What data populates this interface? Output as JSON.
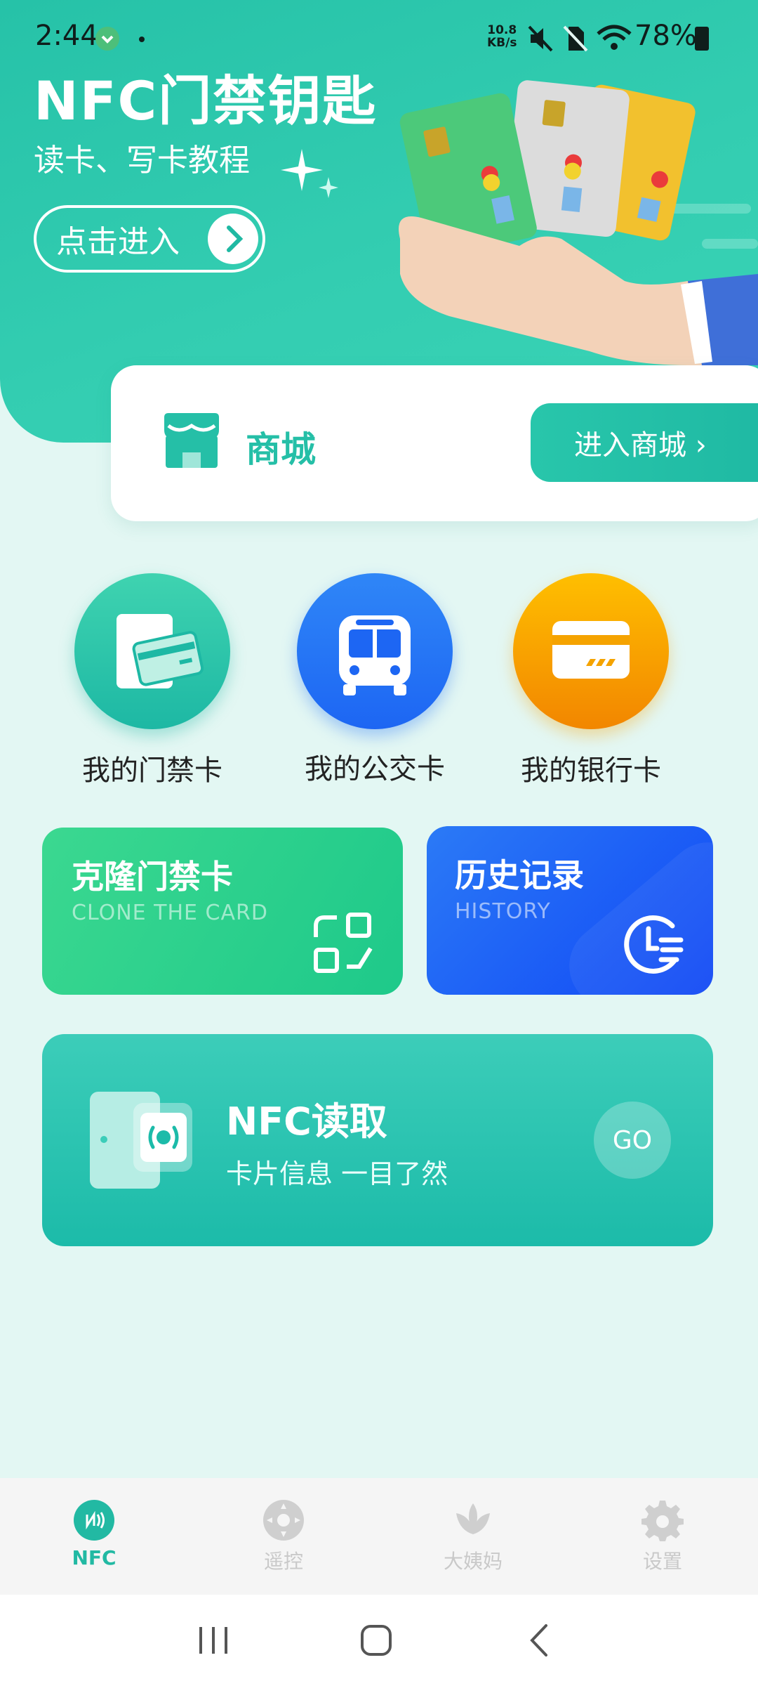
{
  "status": {
    "time": "2:44",
    "net_speed_top": "10.8",
    "net_speed_bottom": "KB/s",
    "battery": "78%"
  },
  "hero": {
    "title": "NFC门禁钥匙",
    "subtitle": "读卡、写卡教程",
    "enter_button": "点击进入"
  },
  "store": {
    "label": "商城",
    "button": "进入商城 ›"
  },
  "quick_actions": [
    {
      "label": "我的门禁卡",
      "icon": "access-card-icon"
    },
    {
      "label": "我的公交卡",
      "icon": "bus-icon"
    },
    {
      "label": "我的银行卡",
      "icon": "bank-card-icon"
    }
  ],
  "cards": {
    "clone": {
      "title": "克隆门禁卡",
      "subtitle": "CLONE THE CARD"
    },
    "history": {
      "title": "历史记录",
      "subtitle": "HISTORY"
    },
    "nfc": {
      "title": "NFC读取",
      "subtitle": "卡片信息 一目了然",
      "go": "GO"
    }
  },
  "tabs": [
    {
      "label": "NFC",
      "icon": "nfc-icon",
      "active": true
    },
    {
      "label": "遥控",
      "icon": "remote-icon",
      "active": false
    },
    {
      "label": "大姨妈",
      "icon": "lotus-icon",
      "active": false
    },
    {
      "label": "设置",
      "icon": "gear-icon",
      "active": false
    }
  ],
  "colors": {
    "accent": "#22b9a3",
    "bus_blue": "#1f6ff5",
    "bank_orange": "#f7a000",
    "clone_green": "#2ad08d",
    "history_blue": "#1b5cf5"
  }
}
